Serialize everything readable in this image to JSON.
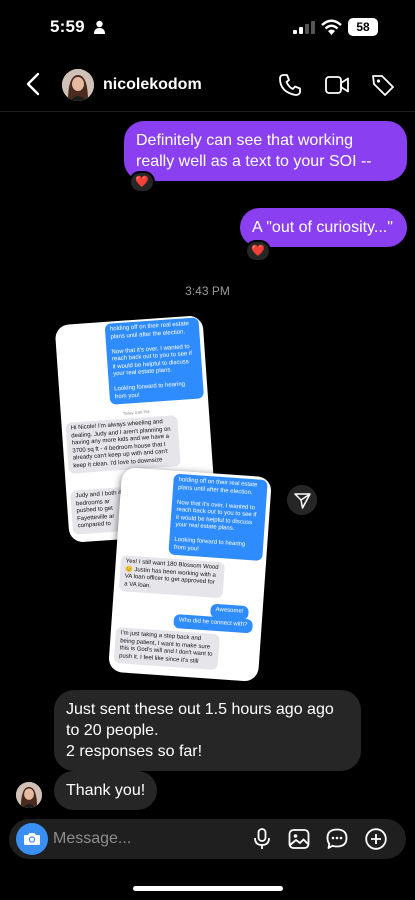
{
  "status_bar": {
    "time": "5:59",
    "battery": "58"
  },
  "header": {
    "username": "nicolekodom"
  },
  "messages": [
    {
      "text": "Definitely can see that working really well as a text to your SOI --",
      "reaction": "❤️"
    },
    {
      "text": "A \"out of curiosity...\"",
      "reaction": "❤️"
    }
  ],
  "timestamp": "3:43 PM",
  "shared_image_1": {
    "top_blue": "holding off on their real estate plans until after the election.\n\nNow that it's over, I wanted to reach back out to you to see if it would be helpful to discuss your real estate plans.\n\nLooking forward to hearing from you!",
    "day_label": "Today 3:59 PM",
    "grey_reply": "Hi Nicole! I'm always wheeling and dealing. Judy and I aren't planning on having any more kids and we have a 3700 sq ft - 4 bedroom house that I already can't keep up with and can't keep it clean. I'd love to downsize",
    "grey_reply_2": "Judy and I both 4 bedrooms ar pushed to get Fayetteville ar compared to"
  },
  "shared_image_2": {
    "top_blue": "holding off on their real estate plans until after the election.\n\nNow that it's over, I wanted to reach back out to you to see if it would be helpful to discuss your real estate plans.\n\nLooking forward to hearing from you!",
    "grey_1": "Yes! I still want 180 Blossom Wood 😊 Justin has been working with a VA loan officer to get approved for a VA loan.",
    "blue_1": "Awesome!",
    "blue_2": "Who did he connect with?",
    "grey_2": "I'm just taking a step back and being patient, I want to make sure this is God's will and I don't want to push it. I feel like since it's still"
  },
  "incoming": [
    {
      "text": "Just sent these out 1.5 hours ago ago to 20 people.\n2 responses so far!"
    },
    {
      "text": "Thank you!"
    }
  ],
  "composer": {
    "placeholder": "Message..."
  },
  "colors": {
    "outgoing": "#8a3ff0",
    "incoming": "#262626",
    "camera": "#3a8ff5",
    "imessage_blue": "#2f8cff"
  }
}
